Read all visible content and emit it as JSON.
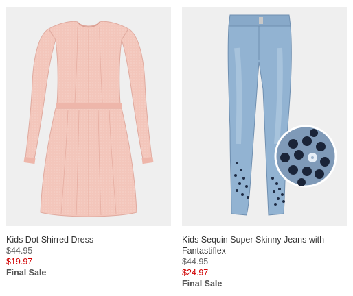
{
  "products": [
    {
      "name": "Kids Dot Shirred Dress",
      "original_price": "$44.95",
      "sale_price": "$19.97",
      "final_sale_label": "Final Sale",
      "image_icon": "pink-dress-image"
    },
    {
      "name": "Kids Sequin Super Skinny Jeans with Fantastiflex",
      "original_price": "$44.95",
      "sale_price": "$24.97",
      "final_sale_label": "Final Sale",
      "image_icon": "sequin-jeans-image"
    }
  ],
  "colors": {
    "sale_price": "#d00000",
    "image_background": "#efefef",
    "dress": "#f2c3b8",
    "denim": "#8fb0cf"
  }
}
